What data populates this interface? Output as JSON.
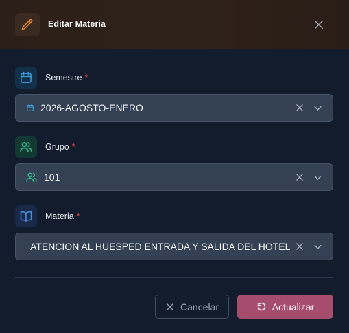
{
  "dialog": {
    "title": "Editar Materia",
    "header_icon": "pencil-icon",
    "close_icon": "close-icon"
  },
  "fields": {
    "semestre": {
      "label": "Semestre",
      "required_mark": "*",
      "label_icon": "calendar-icon",
      "value": "2026-AGOSTO-ENERO",
      "value_icon": "calendar-icon"
    },
    "grupo": {
      "label": "Grupo",
      "required_mark": "*",
      "label_icon": "users-icon",
      "value": "101",
      "value_icon": "users-icon"
    },
    "materia": {
      "label": "Materia",
      "required_mark": "*",
      "label_icon": "book-open-icon",
      "value": "ATENCION AL HUESPED ENTRADA Y SALIDA DEL HOTEL"
    }
  },
  "actions": {
    "cancel_label": "Cancelar",
    "update_label": "Actualizar"
  },
  "colors": {
    "accent_orange": "#e4862f",
    "calendar_blue": "#3b9fe0",
    "users_green": "#34c38f",
    "book_blue": "#4b8fe8",
    "required_red": "#ef4444",
    "update_button": "#a64c6c"
  }
}
